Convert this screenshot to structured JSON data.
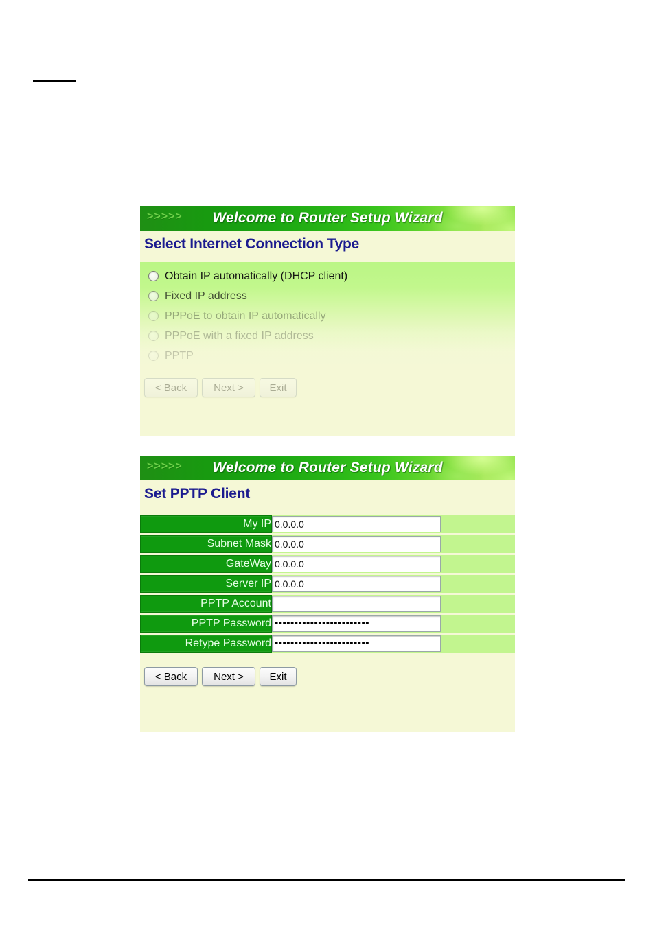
{
  "page": {
    "top_rule": "",
    "bottom_rule": ""
  },
  "panels": [
    {
      "id": "connection-type",
      "titlebar": {
        "chevrons": ">>>>>",
        "title": "Welcome to Router Setup Wizard"
      },
      "heading": "Select Internet Connection Type",
      "options": [
        {
          "label": "Obtain IP automatically (DHCP client)",
          "selected": false
        },
        {
          "label": "Fixed IP address",
          "selected": false
        },
        {
          "label": "PPPoE to obtain IP automatically",
          "selected": false
        },
        {
          "label": "PPPoE with a fixed IP address",
          "selected": false
        },
        {
          "label": "PPTP",
          "selected": false
        }
      ],
      "buttons": {
        "back": "< Back",
        "next": "Next >",
        "exit": "Exit"
      }
    },
    {
      "id": "pptp-client",
      "titlebar": {
        "chevrons": ">>>>>",
        "title": "Welcome to Router Setup Wizard"
      },
      "heading": "Set PPTP Client",
      "fields": [
        {
          "label": "My IP",
          "value": "0.0.0.0",
          "type": "text"
        },
        {
          "label": "Subnet Mask",
          "value": "0.0.0.0",
          "type": "text"
        },
        {
          "label": "GateWay",
          "value": "0.0.0.0",
          "type": "text"
        },
        {
          "label": "Server IP",
          "value": "0.0.0.0",
          "type": "text"
        },
        {
          "label": "PPTP Account",
          "value": "",
          "type": "text"
        },
        {
          "label": "PPTP Password",
          "value": "••••••••••••••••••••••••",
          "type": "password"
        },
        {
          "label": "Retype Password",
          "value": "••••••••••••••••••••••••",
          "type": "password"
        }
      ],
      "buttons": {
        "back": "< Back",
        "next": "Next >",
        "exit": "Exit"
      }
    }
  ],
  "colors": {
    "titlebar_dark_green": "#1f8f14",
    "titlebar_light_green": "#8fe248",
    "heading_blue": "#1b1b8f",
    "panel_bg": "#f5f8d6",
    "label_green": "#0f9a0f",
    "field_row_green": "#c2f58f"
  }
}
